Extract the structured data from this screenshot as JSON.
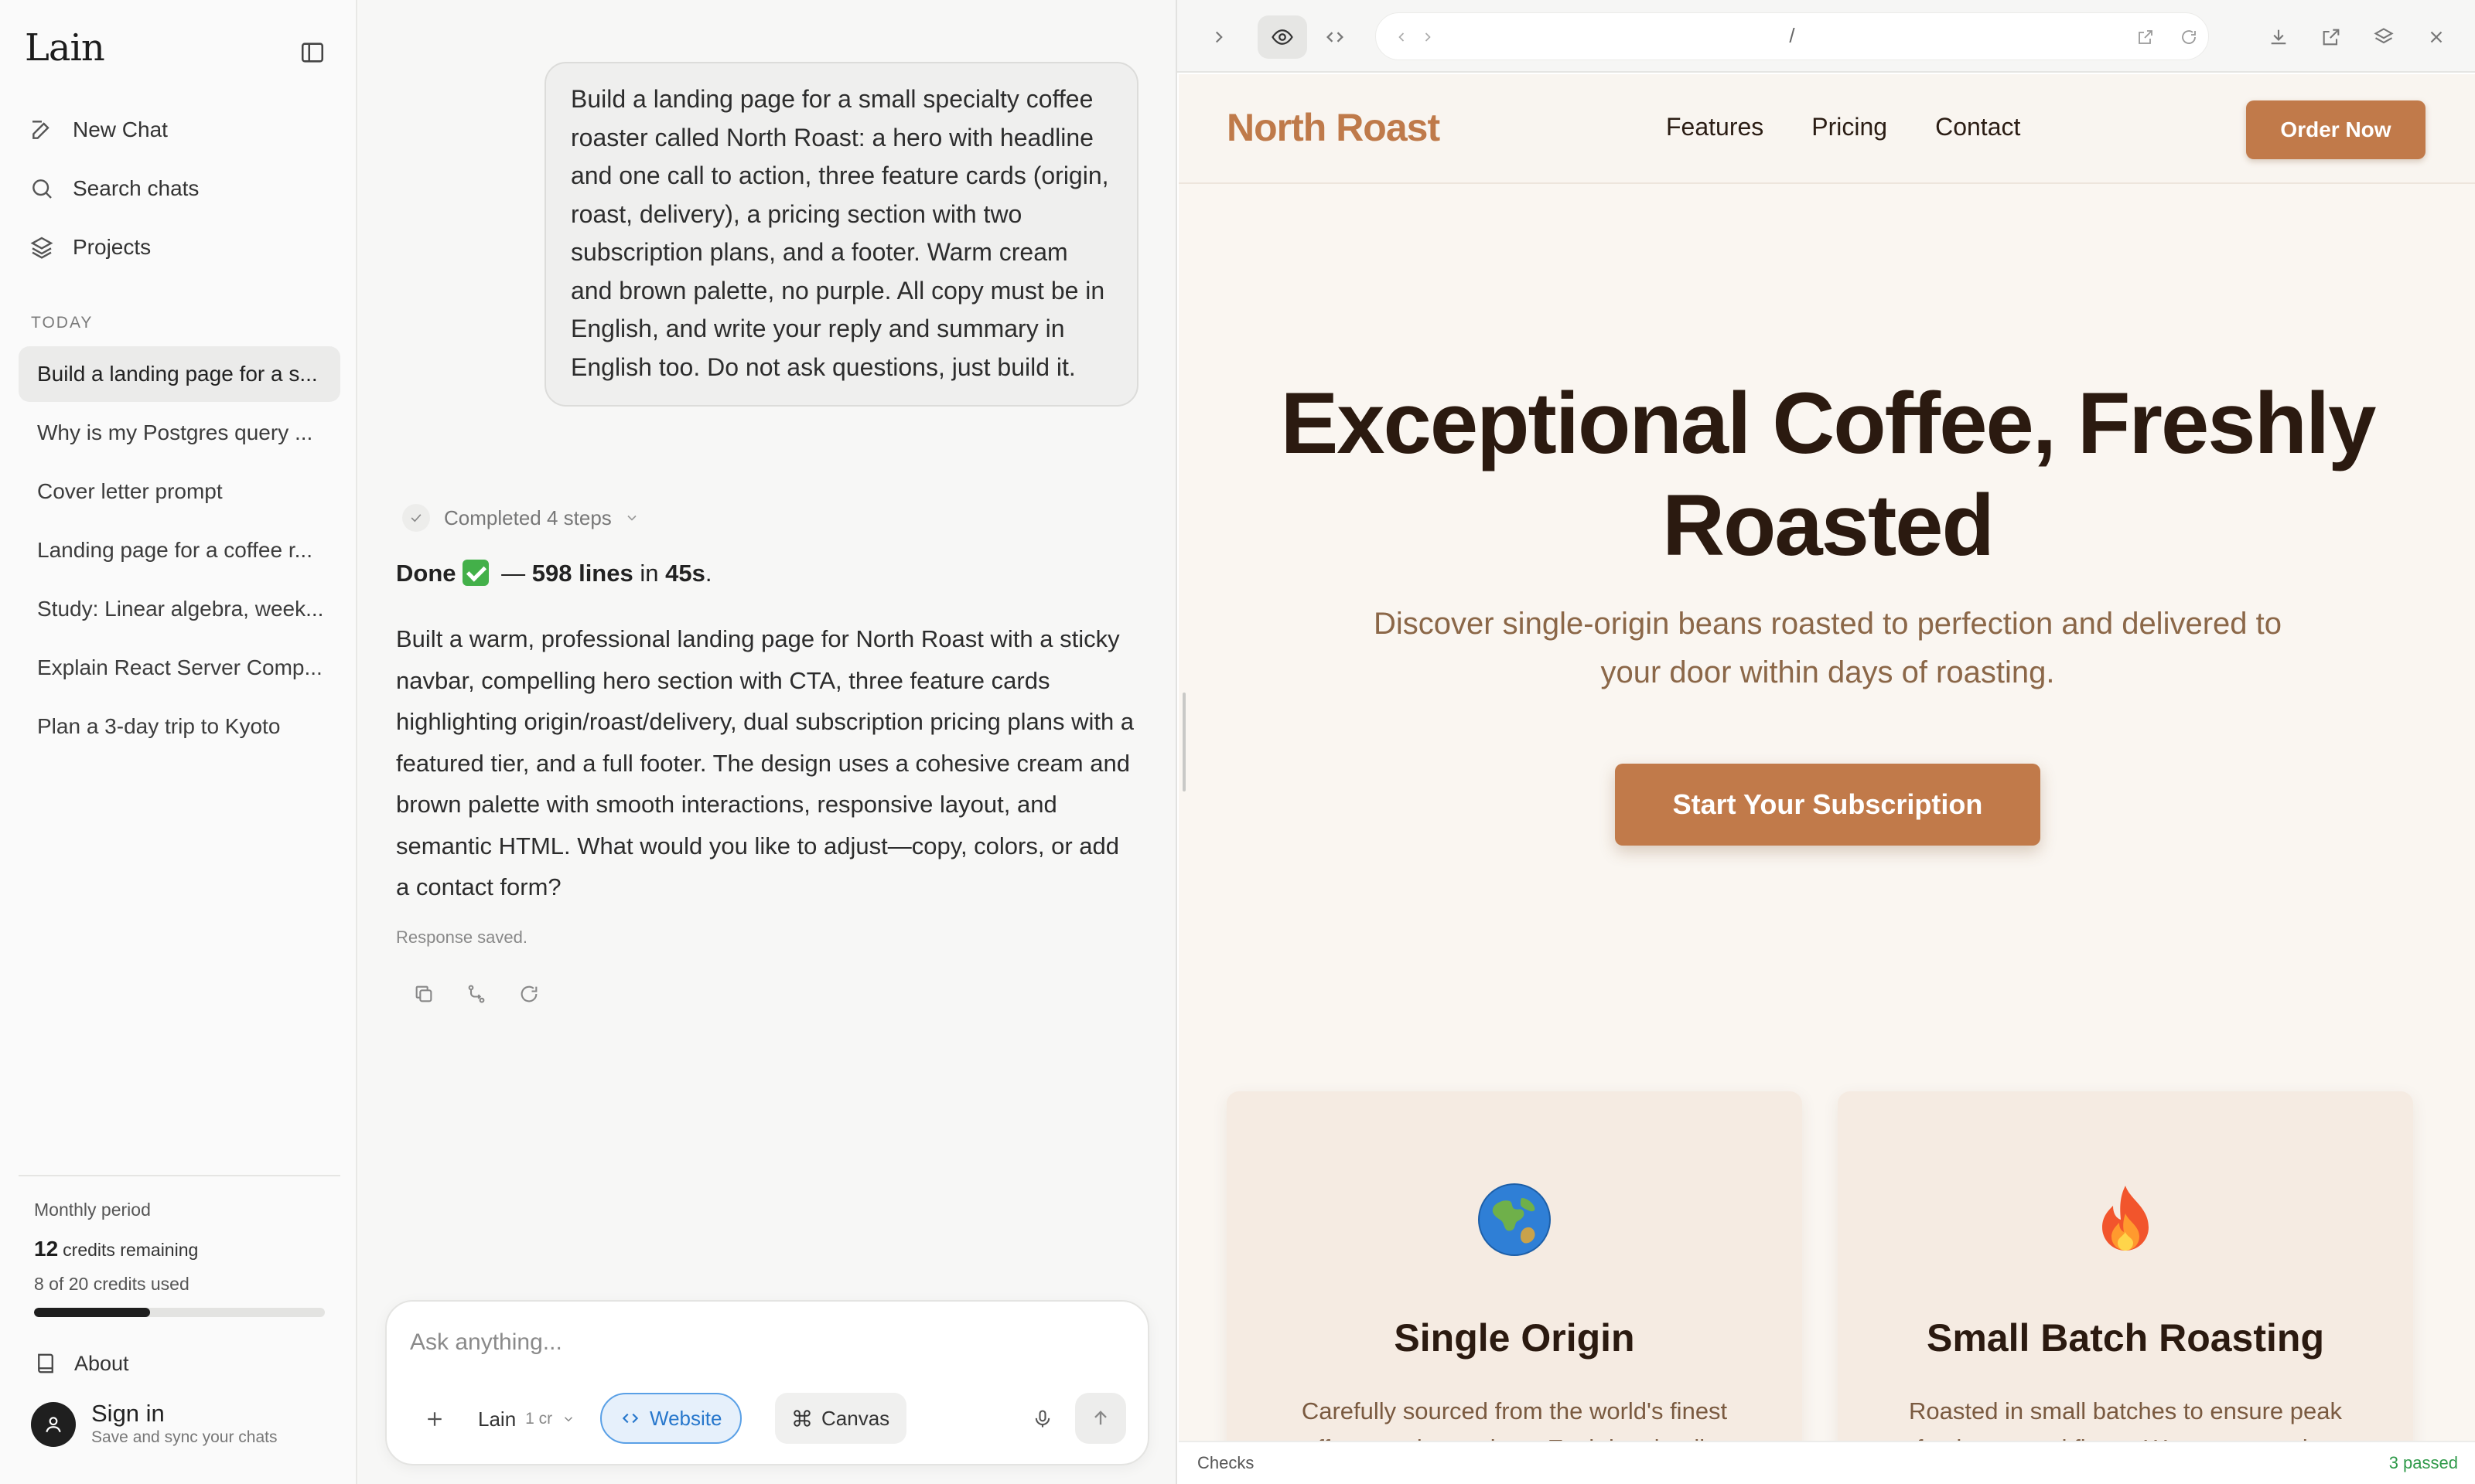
{
  "sidebar": {
    "logo": "Lain",
    "nav": [
      {
        "label": "New Chat",
        "icon": "edit-icon"
      },
      {
        "label": "Search chats",
        "icon": "search-icon"
      },
      {
        "label": "Projects",
        "icon": "layers-icon"
      }
    ],
    "section_label": "TODAY",
    "chats": [
      {
        "label": "Build a landing page for a s...",
        "active": true
      },
      {
        "label": "Why is my Postgres query ...",
        "active": false
      },
      {
        "label": "Cover letter prompt",
        "active": false
      },
      {
        "label": "Landing page for a coffee r...",
        "active": false
      },
      {
        "label": "Study: Linear algebra, week...",
        "active": false
      },
      {
        "label": "Explain React Server Comp...",
        "active": false
      },
      {
        "label": "Plan a 3-day trip to Kyoto",
        "active": false
      }
    ],
    "credits": {
      "period": "Monthly period",
      "remaining_count": "12",
      "remaining_label": "credits remaining",
      "used_text": "8 of 20 credits used",
      "used_fraction": 0.4
    },
    "about": "About",
    "signin": {
      "title": "Sign in",
      "subtitle": "Save and sync your chats"
    }
  },
  "chat": {
    "user_message": "Build a landing page for a small specialty coffee roaster called North Roast: a hero with headline and one call to action, three feature cards (origin, roast, delivery), a pricing section with two subscription plans, and a footer. Warm cream and brown palette, no purple. All copy must be in English, and write your reply and summary in English too. Do not ask questions, just build it.",
    "steps_label": "Completed 4 steps",
    "done": {
      "word": "Done",
      "dash": "—",
      "lines": "598 lines",
      "in": "in",
      "time": "45s",
      "period": "."
    },
    "reply": "Built a warm, professional landing page for North Roast with a sticky navbar, compelling hero section with CTA, three feature cards highlighting origin/roast/delivery, dual subscription pricing plans with a featured tier, and a full footer. The design uses a cohesive cream and brown palette with smooth interactions, responsive layout, and semantic HTML. What would you like to adjust—copy, colors, or add a contact form?",
    "saved_label": "Response saved.",
    "composer": {
      "placeholder": "Ask anything...",
      "model": "Lain",
      "model_credit": "1 cr",
      "website_label": "Website",
      "canvas_label": "Canvas"
    }
  },
  "preview": {
    "url": "/",
    "site": {
      "brand": "North Roast",
      "nav_links": [
        "Features",
        "Pricing",
        "Contact"
      ],
      "order_button": "Order Now",
      "hero_title": "Exceptional Coffee, Freshly Roasted",
      "hero_subtitle": "Discover single-origin beans roasted to perfection and delivered to your door within days of roasting.",
      "cta": "Start Your Subscription",
      "features": [
        {
          "icon": "globe-icon",
          "title": "Single Origin",
          "desc": "Carefully sourced from the world's finest coffee-growing regions. Each batch tells a"
        },
        {
          "icon": "fire-icon",
          "title": "Small Batch Roasting",
          "desc": "Roasted in small batches to ensure peak freshness and flavor. We roast to order, never"
        }
      ]
    },
    "checks_label": "Checks",
    "checks_status": "3 passed"
  },
  "colors": {
    "brand": "#bf7a4a",
    "button": "#c17a4a",
    "cream": "#faf6f1",
    "dark_brown": "#2b1a10",
    "website_pill": "#2777cc",
    "passed": "#2f9a4a"
  }
}
